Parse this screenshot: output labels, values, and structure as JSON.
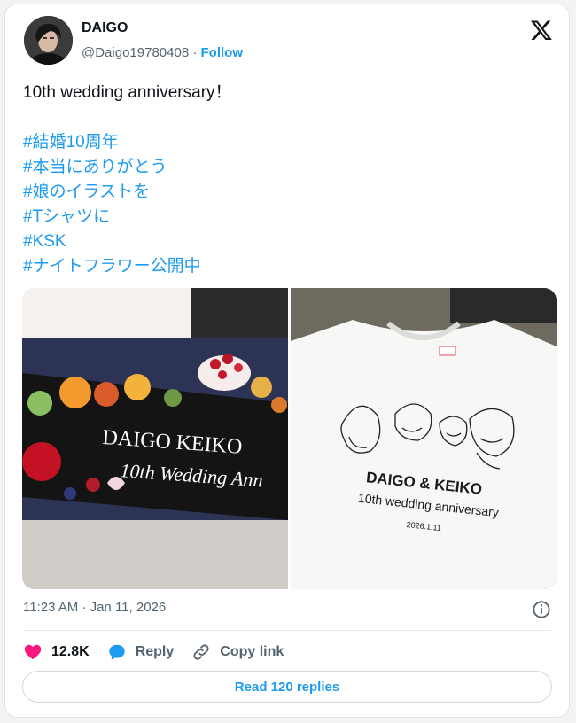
{
  "author": {
    "name": "DAIGO",
    "handle": "@Daigo19780408",
    "separator": "·",
    "follow_label": "Follow"
  },
  "tweet": {
    "text": "10th wedding anniversary！",
    "hashtags": [
      "#結婚10周年",
      "#本当にありがとう",
      "#娘のイラストを",
      "#Tシャツに",
      "#KSK",
      "#ナイトフラワー公開中"
    ]
  },
  "media": {
    "cake": {
      "line1": "DAIGO KEIKO",
      "line2": "10th Wedding Ann"
    },
    "tshirt": {
      "line1": "DAIGO & KEIKO",
      "line2": "10th wedding anniversary",
      "line3": "2026.1.11"
    }
  },
  "timestamp": "11:23 AM · Jan 11, 2026",
  "actions": {
    "likes": "12.8K",
    "reply_label": "Reply",
    "copy_label": "Copy link"
  },
  "read_replies_label": "Read 120 replies",
  "colors": {
    "accent": "#1d9bf0",
    "like": "#f91880",
    "text": "#0f1419",
    "muted": "#536471"
  },
  "icons": [
    "x-logo-icon",
    "info-icon",
    "heart-icon",
    "reply-bubble-icon",
    "link-icon"
  ]
}
